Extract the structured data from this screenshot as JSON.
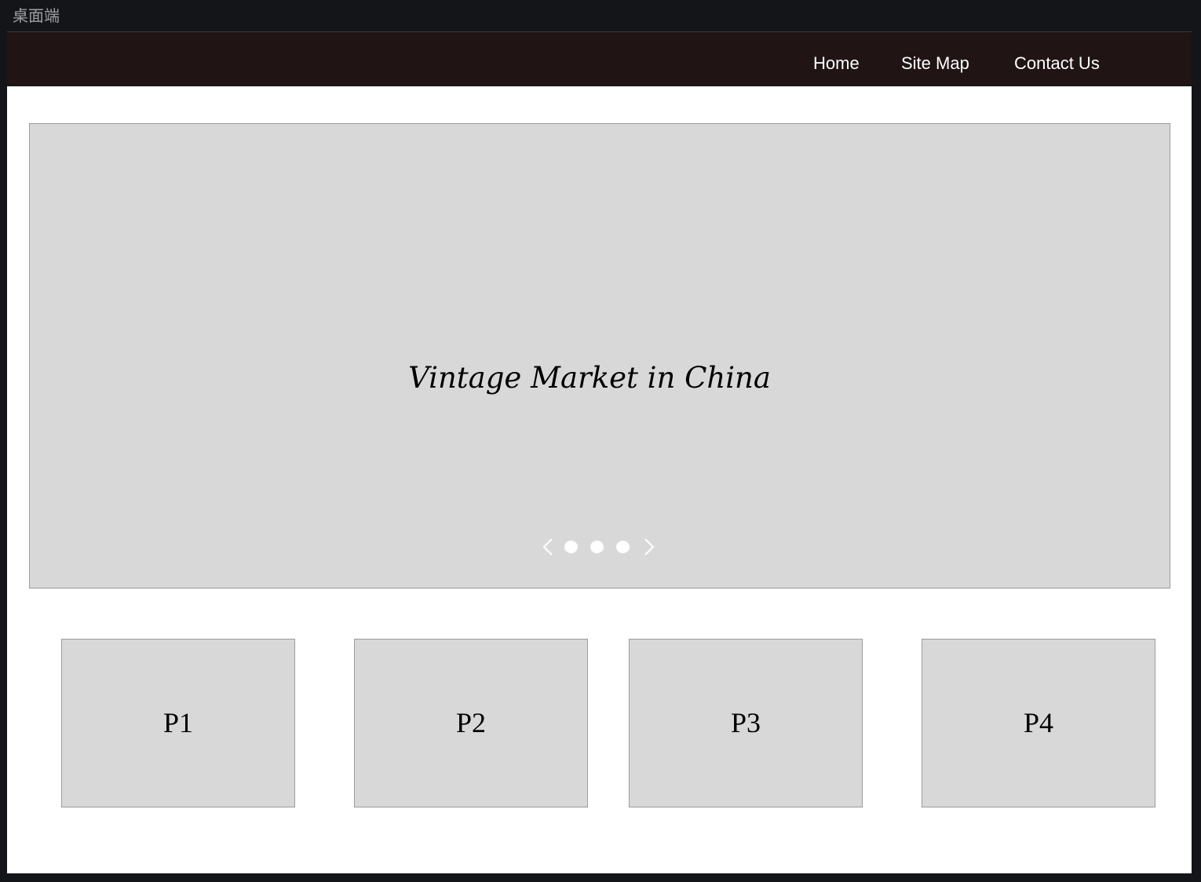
{
  "frame": {
    "label": "桌面端"
  },
  "navbar": {
    "background": "#211415",
    "links": [
      {
        "label": "Home"
      },
      {
        "label": "Site Map"
      },
      {
        "label": "Contact Us"
      }
    ]
  },
  "carousel": {
    "title": "Vintage Market in China",
    "slide_count": 3,
    "prev_icon": "chevron-left-icon",
    "next_icon": "chevron-right-icon"
  },
  "cards": [
    {
      "label": "P1"
    },
    {
      "label": "P2"
    },
    {
      "label": "P3"
    },
    {
      "label": "P4"
    }
  ],
  "colors": {
    "placeholder_fill": "#d8d8d8",
    "placeholder_border": "#9b9b9b",
    "canvas_background": "#131518"
  }
}
